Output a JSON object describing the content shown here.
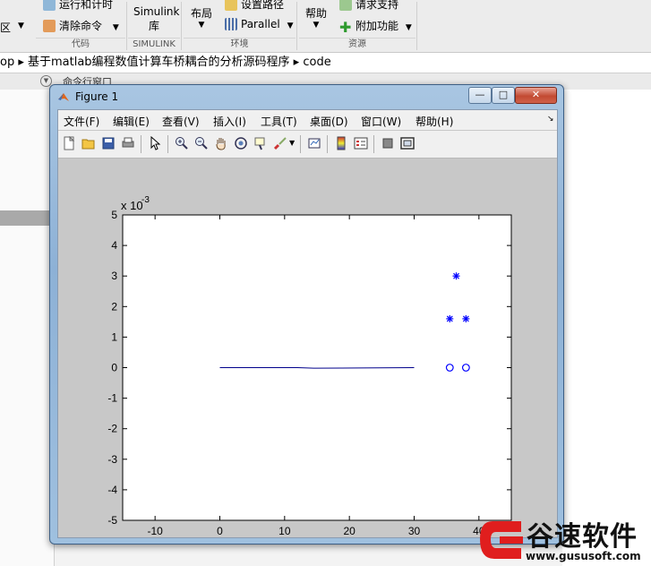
{
  "ribbon": {
    "run_and_time": "运行和计时",
    "clear_commands": "清除命令",
    "area_partial": "区",
    "simulink_btn_line1": "Simulink",
    "simulink_btn_line2": "库",
    "layout": "布局",
    "set_path": "设置路径",
    "parallel": "Parallel",
    "help": "帮助",
    "request_support": "请求支持",
    "addons": "附加功能",
    "group_code": "代码",
    "group_simulink": "SIMULINK",
    "group_environment": "环境",
    "group_resources": "资源"
  },
  "address": {
    "path": "op  ▸ 基于matlab编程数值计算车桥耦合的分析源码程序  ▸  code"
  },
  "command_window_label": "命令行窗口",
  "figure": {
    "title": "Figure 1",
    "window_buttons": {
      "min": "—",
      "max": "□",
      "close": "✕"
    },
    "menu": [
      "文件(F)",
      "编辑(E)",
      "查看(V)",
      "插入(I)",
      "工具(T)",
      "桌面(D)",
      "窗口(W)",
      "帮助(H)"
    ]
  },
  "chart_data": {
    "type": "scatter",
    "title": "",
    "xlabel": "",
    "ylabel": "",
    "y_exponent_label": "x 10",
    "y_exponent_power": "-3",
    "xlim": [
      -15,
      45
    ],
    "ylim": [
      -5,
      5
    ],
    "xticks": [
      "-10",
      "0",
      "10",
      "20",
      "30",
      "40"
    ],
    "yticks": [
      "5",
      "4",
      "3",
      "2",
      "1",
      "0",
      "-1",
      "-2",
      "-3",
      "-4",
      "-5"
    ],
    "line": {
      "x": [
        0,
        12,
        14.5,
        30
      ],
      "y": [
        0,
        0,
        -0.02,
        0
      ],
      "color": "#00008b"
    },
    "stars": {
      "x": [
        36.5,
        35.5,
        38
      ],
      "y": [
        3.0,
        1.6,
        1.6
      ],
      "color": "#0000ff"
    },
    "circles": {
      "x": [
        35.5,
        38
      ],
      "y": [
        0,
        0
      ],
      "color": "#0000ff"
    },
    "grid": false
  },
  "watermark": {
    "brand": "谷速软件",
    "url": "www.gususoft.com"
  }
}
